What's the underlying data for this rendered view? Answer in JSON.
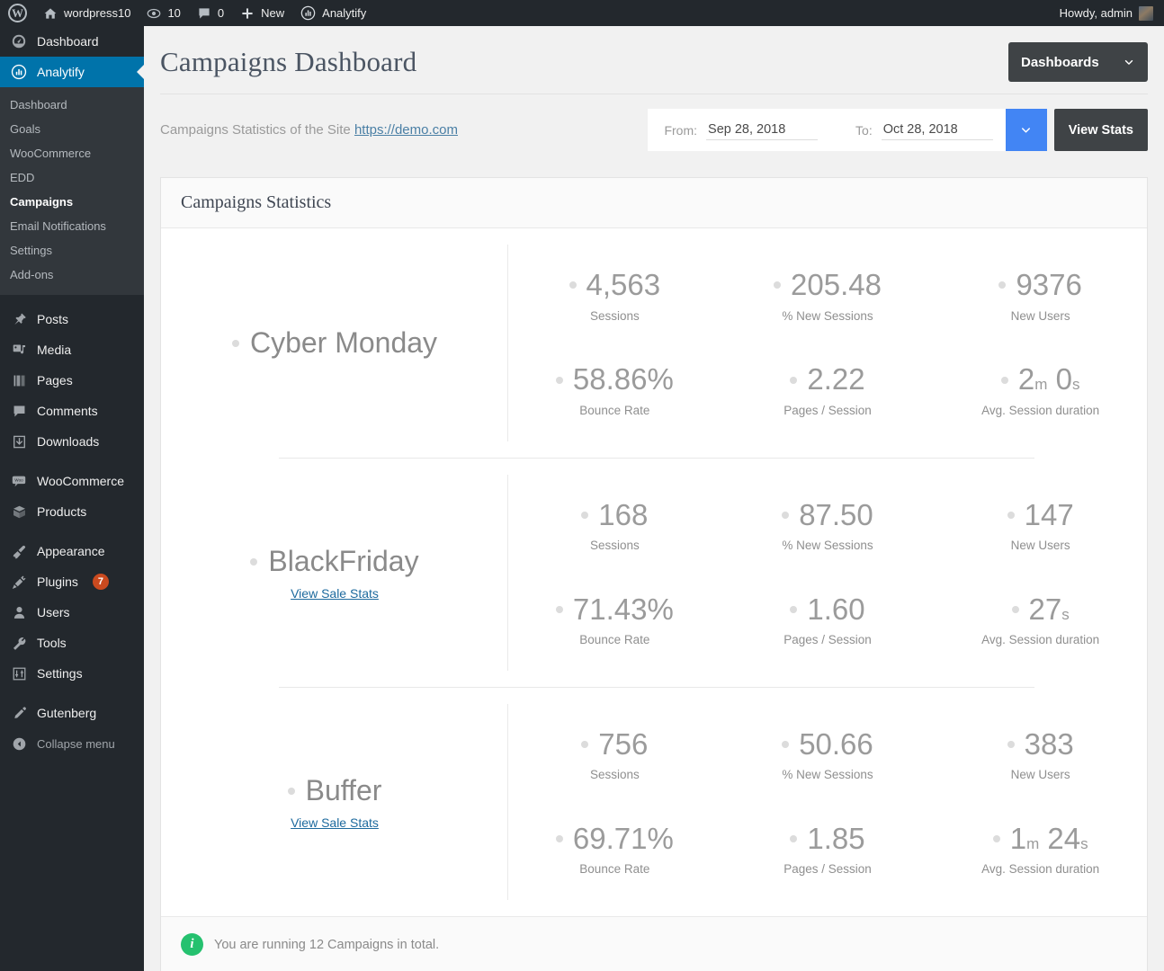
{
  "adminbar": {
    "site_name": "wordpress10",
    "updates_count": "10",
    "comments_count": "0",
    "new_label": "New",
    "analytify_label": "Analytify",
    "howdy": "Howdy, admin"
  },
  "sidebar": {
    "top_items": [
      {
        "label": "Dashboard",
        "icon": "dashboard-icon",
        "current": false
      },
      {
        "label": "Analytify",
        "icon": "analytify-icon",
        "current": true
      }
    ],
    "analytify_submenu": [
      {
        "label": "Dashboard",
        "active": false
      },
      {
        "label": "Goals",
        "active": false
      },
      {
        "label": "WooCommerce",
        "active": false
      },
      {
        "label": "EDD",
        "active": false
      },
      {
        "label": "Campaigns",
        "active": true
      },
      {
        "label": "Email Notifications",
        "active": false
      },
      {
        "label": "Settings",
        "active": false
      },
      {
        "label": "Add-ons",
        "active": false
      }
    ],
    "group2": [
      {
        "label": "Posts",
        "icon": "pin-icon"
      },
      {
        "label": "Media",
        "icon": "media-icon"
      },
      {
        "label": "Pages",
        "icon": "pages-icon"
      },
      {
        "label": "Comments",
        "icon": "comment-icon"
      },
      {
        "label": "Downloads",
        "icon": "download-icon"
      }
    ],
    "group3": [
      {
        "label": "WooCommerce",
        "icon": "woocommerce-icon"
      },
      {
        "label": "Products",
        "icon": "products-icon"
      }
    ],
    "group4": [
      {
        "label": "Appearance",
        "icon": "brush-icon"
      },
      {
        "label": "Plugins",
        "icon": "plug-icon",
        "badge": "7"
      },
      {
        "label": "Users",
        "icon": "user-icon"
      },
      {
        "label": "Tools",
        "icon": "wrench-icon"
      },
      {
        "label": "Settings",
        "icon": "sliders-icon"
      }
    ],
    "group5": [
      {
        "label": "Gutenberg",
        "icon": "pencil-icon"
      }
    ],
    "collapse_label": "Collapse menu"
  },
  "header": {
    "title": "Campaigns Dashboard",
    "dashboards_label": "Dashboards"
  },
  "subbar": {
    "text_prefix": "Campaigns Statistics of the Site",
    "site_url": "https://demo.com",
    "from_label": "From:",
    "from_value": "Sep 28, 2018",
    "to_label": "To:",
    "to_value": "Oct 28, 2018",
    "view_stats_label": "View Stats"
  },
  "panel": {
    "title": "Campaigns Statistics",
    "footer_text": "You are running 12 Campaigns in total.",
    "stat_labels": {
      "sessions": "Sessions",
      "new_sessions": "% New Sessions",
      "new_users": "New Users",
      "bounce_rate": "Bounce Rate",
      "pages_session": "Pages / Session",
      "avg_duration": "Avg. Session duration"
    },
    "view_sale_stats_label": "View Sale Stats",
    "campaigns": [
      {
        "name": "Cyber Monday",
        "has_sale_link": false,
        "sessions": "4,563",
        "new_sessions": "205.48",
        "new_users": "9376",
        "bounce_rate": "58.86%",
        "pages_session": "2.22",
        "avg_duration_parts": [
          {
            "num": "2",
            "unit": "m"
          },
          {
            "num": "0",
            "unit": "s"
          }
        ]
      },
      {
        "name": "BlackFriday",
        "has_sale_link": true,
        "sessions": "168",
        "new_sessions": "87.50",
        "new_users": "147",
        "bounce_rate": "71.43%",
        "pages_session": "1.60",
        "avg_duration_parts": [
          {
            "num": "27",
            "unit": "s"
          }
        ]
      },
      {
        "name": "Buffer",
        "has_sale_link": true,
        "sessions": "756",
        "new_sessions": "50.66",
        "new_users": "383",
        "bounce_rate": "69.71%",
        "pages_session": "1.85",
        "avg_duration_parts": [
          {
            "num": "1",
            "unit": "m"
          },
          {
            "num": "24",
            "unit": "s"
          }
        ]
      }
    ]
  },
  "colors": {
    "admin_bar": "#23282d",
    "sidebar": "#23282d",
    "accent_blue": "#0073aa",
    "date_caret_blue": "#4285f4",
    "dark_button": "#3f4346",
    "info_green": "#25c16f",
    "badge_orange": "#ca4a1f"
  }
}
